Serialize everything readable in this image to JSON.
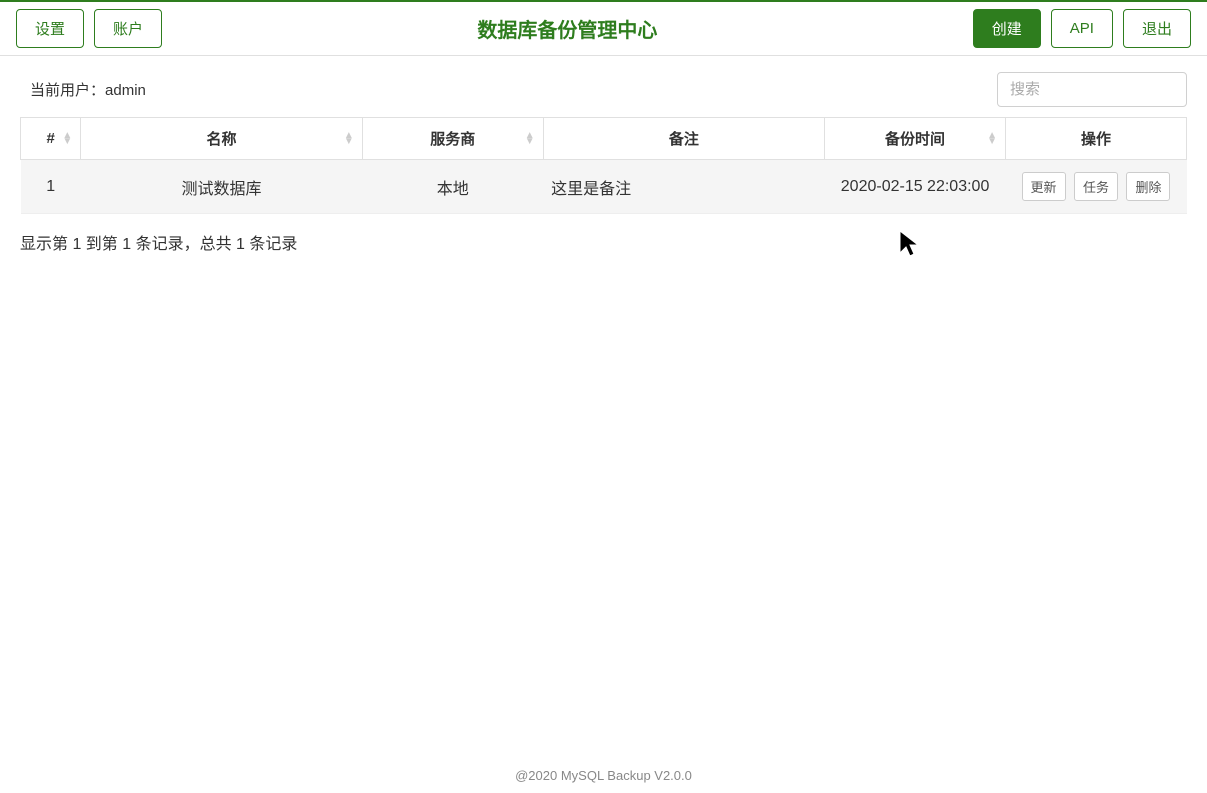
{
  "header": {
    "title": "数据库备份管理中心",
    "left_buttons": {
      "settings": "设置",
      "account": "账户"
    },
    "right_buttons": {
      "create": "创建",
      "api": "API",
      "logout": "退出"
    }
  },
  "user_info": {
    "label": "当前用户：",
    "username": "admin"
  },
  "search": {
    "placeholder": "搜索"
  },
  "table": {
    "columns": {
      "index": "#",
      "name": "名称",
      "provider": "服务商",
      "remark": "备注",
      "backup_time": "备份时间",
      "actions": "操作"
    },
    "rows": [
      {
        "index": "1",
        "name": "测试数据库",
        "provider": "本地",
        "remark": "这里是备注",
        "backup_time": "2020-02-15 22:03:00"
      }
    ],
    "action_buttons": {
      "update": "更新",
      "task": "任务",
      "delete": "删除"
    },
    "footer_text": "显示第 1 到第 1 条记录，总共 1 条记录"
  },
  "footer": {
    "copyright": "@2020 MySQL Backup V2.0.0"
  }
}
